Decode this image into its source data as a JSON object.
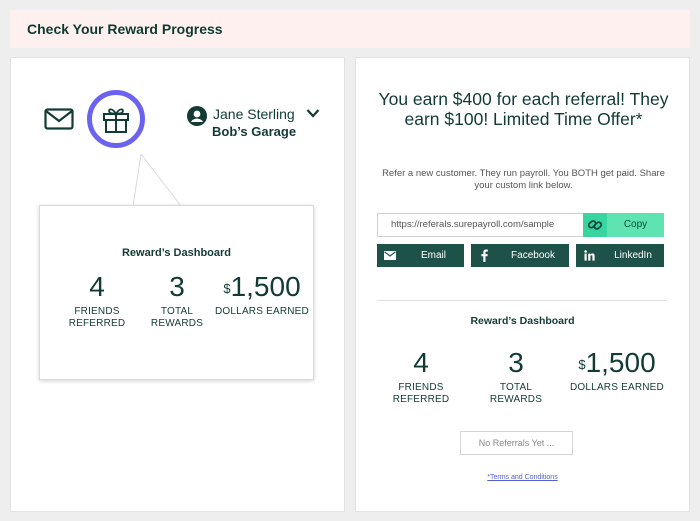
{
  "header": {
    "title": "Check Your Reward Progress"
  },
  "user": {
    "name": "Jane Sterling",
    "company": "Bob’s Garage"
  },
  "icons": {
    "mail": "mail-icon",
    "gift": "gift-icon",
    "user": "user-avatar-icon",
    "chevron": "chevron-down-icon",
    "link": "link-icon",
    "facebook": "facebook-icon",
    "linkedin": "linkedin-icon"
  },
  "colors": {
    "brand_dark": "#123b35",
    "accent_purple": "#6b63ef",
    "copy_green": "#5fe3b3",
    "share_dark": "#1e5147",
    "header_bg": "#fdf0ee"
  },
  "dashboard": {
    "title": "Reward’s Dashboard",
    "stats": [
      {
        "value": "4",
        "label": "FRIENDS REFERRED"
      },
      {
        "value": "3",
        "label": "TOTAL REWARDS"
      },
      {
        "currency": "$",
        "value": "1,500",
        "label": "DOLLARS EARNED"
      }
    ]
  },
  "offer": {
    "headline": "You earn $400 for each referral! They earn $100! Limited Time Offer*",
    "subtext": "Refer a new customer. They run payroll. You BOTH get paid. Share your custom link below.",
    "link": "https://referals.surepayroll.com/sample",
    "copy_label": "Copy"
  },
  "share": {
    "email_label": "Email",
    "facebook_label": "Facebook",
    "linkedin_label": "LinkedIn"
  },
  "referrals": {
    "empty_label": "No Referrals Yet ..."
  },
  "terms_label": "*Terms and Conditions"
}
